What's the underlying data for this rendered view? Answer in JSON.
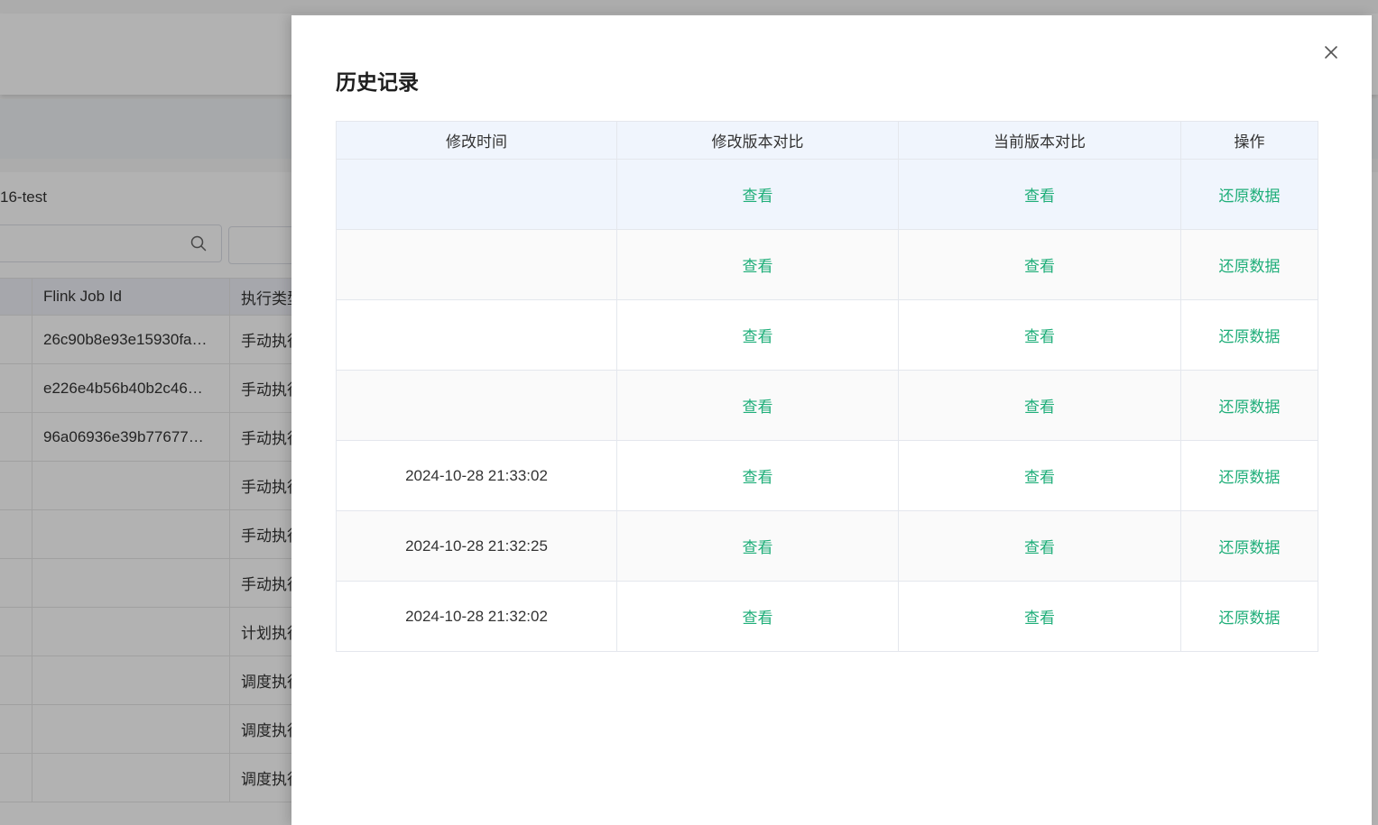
{
  "background": {
    "job_name_suffix": "16-test",
    "table": {
      "headers": [
        "",
        "Flink Job Id",
        "执行类型"
      ],
      "rows": [
        {
          "job_id": "26c90b8e93e15930fa…",
          "exec": "手动执行"
        },
        {
          "job_id": "e226e4b56b40b2c46…",
          "exec": "手动执行"
        },
        {
          "job_id": "96a06936e39b77677…",
          "exec": "手动执行"
        },
        {
          "job_id": "",
          "exec": "手动执行"
        },
        {
          "job_id": "",
          "exec": "手动执行"
        },
        {
          "job_id": "",
          "exec": "手动执行"
        },
        {
          "job_id": "",
          "exec": "计划执行"
        },
        {
          "job_id": "",
          "exec": "调度执行"
        },
        {
          "job_id": "",
          "exec": "调度执行"
        },
        {
          "job_id": "",
          "exec": "调度执行"
        }
      ]
    }
  },
  "drawer": {
    "title": "历史记录",
    "table": {
      "headers": [
        "修改时间",
        "修改版本对比",
        "当前版本对比",
        "操作"
      ],
      "rows": [
        {
          "time": "",
          "diff_prev": "查看",
          "diff_current": "查看",
          "action": "还原数据"
        },
        {
          "time": "",
          "diff_prev": "查看",
          "diff_current": "查看",
          "action": "还原数据"
        },
        {
          "time": "",
          "diff_prev": "查看",
          "diff_current": "查看",
          "action": "还原数据"
        },
        {
          "time": "",
          "diff_prev": "查看",
          "diff_current": "查看",
          "action": "还原数据"
        },
        {
          "time": "2024-10-28 21:33:02",
          "diff_prev": "查看",
          "diff_current": "查看",
          "action": "还原数据"
        },
        {
          "time": "2024-10-28 21:32:25",
          "diff_prev": "查看",
          "diff_current": "查看",
          "action": "还原数据"
        },
        {
          "time": "2024-10-28 21:32:02",
          "diff_prev": "查看",
          "diff_current": "查看",
          "action": "还原数据"
        }
      ]
    }
  },
  "colors": {
    "link": "#1fae79",
    "header_bg": "#f0f5fd",
    "overlay": "rgba(0,0,0,0.30)"
  },
  "icons": [
    "search-icon",
    "close-icon"
  ]
}
